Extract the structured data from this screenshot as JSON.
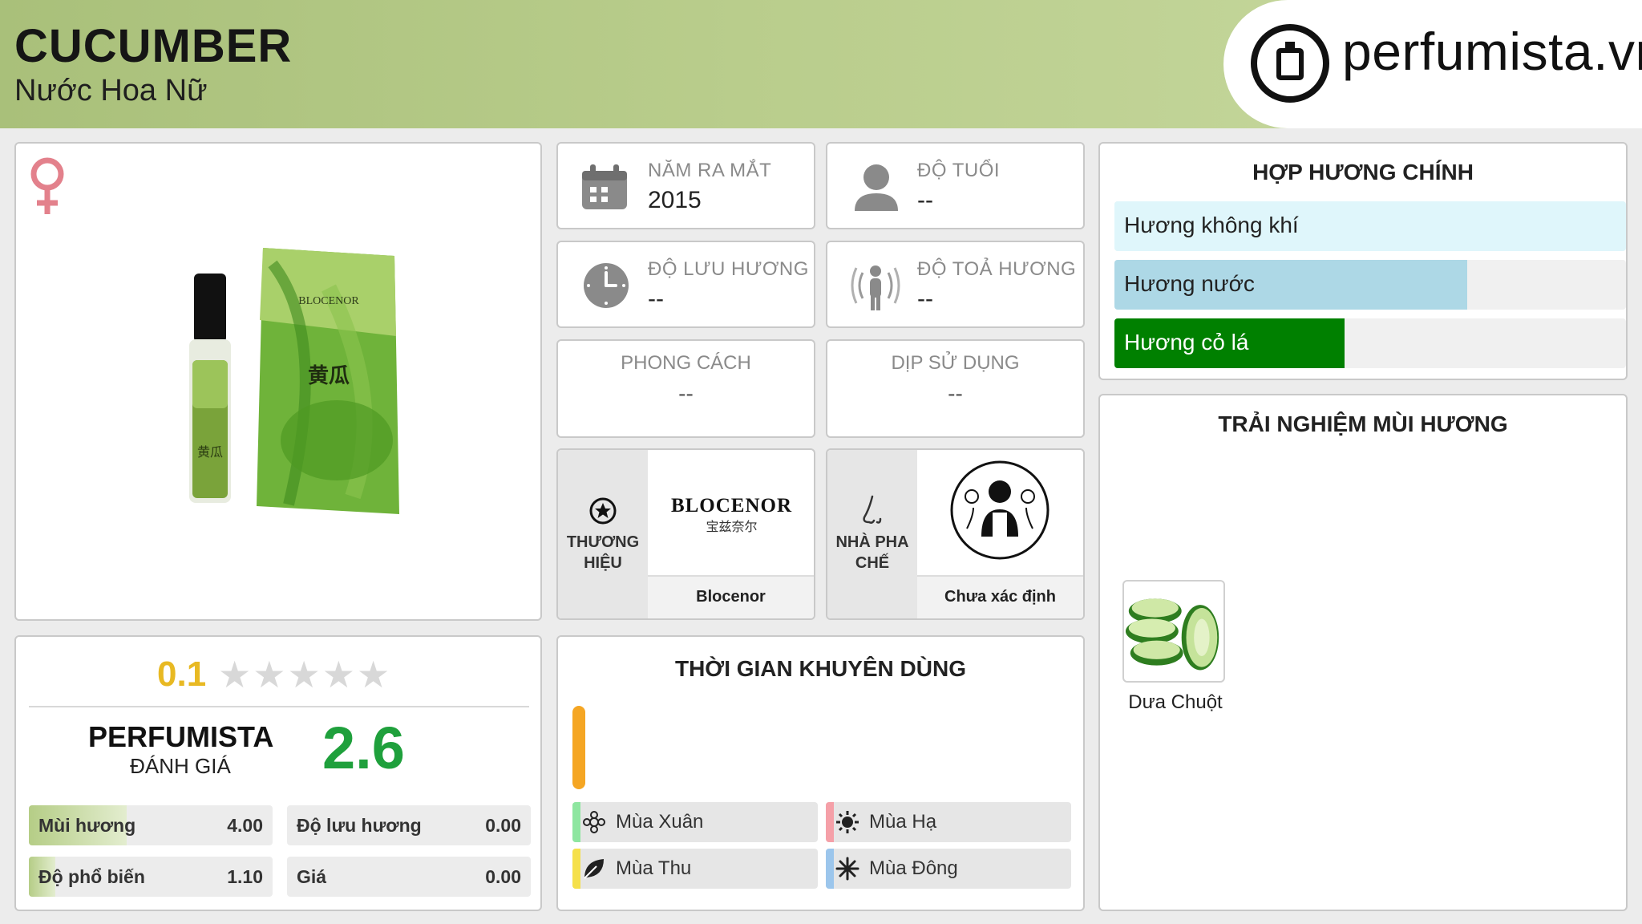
{
  "header": {
    "title": "CUCUMBER",
    "subtitle": "Nước Hoa Nữ",
    "site": "perfumista.vn"
  },
  "product": {
    "gender_icon": "female-icon",
    "image": "perfume-bottle-and-box",
    "packaging_brand_text": "BLOCENOR",
    "packaging_cn_text": "黄瓜"
  },
  "info": {
    "release_year": {
      "label": "NĂM RA MẮT",
      "value": "2015",
      "icon": "calendar-icon"
    },
    "age": {
      "label": "ĐỘ TUỔI",
      "value": "--",
      "icon": "person-icon"
    },
    "longevity": {
      "label": "ĐỘ LƯU HƯƠNG",
      "value": "--",
      "icon": "clock-icon"
    },
    "sillage": {
      "label": "ĐỘ TOẢ HƯƠNG",
      "value": "--",
      "icon": "radiating-person-icon"
    },
    "style": {
      "label": "PHONG CÁCH",
      "value": "--"
    },
    "occasion": {
      "label": "DỊP SỬ DỤNG",
      "value": "--"
    }
  },
  "brand": {
    "label": "THƯƠNG HIỆU",
    "logo_text": "BLOCENOR",
    "logo_cn": "宝兹奈尔",
    "name": "Blocenor",
    "icon": "star-circle-icon"
  },
  "perfumer": {
    "label": "NHÀ PHA CHẾ",
    "name": "Chưa xác định",
    "icon": "nose-icon"
  },
  "accords": {
    "title": "HỢP HƯƠNG CHÍNH",
    "items": [
      {
        "label": "Hương không khí",
        "level": 1.0,
        "color": "#dff6fb",
        "text_color": "#222222"
      },
      {
        "label": "Hương nước",
        "level": 0.69,
        "color": "#add8e6",
        "text_color": "#222222"
      },
      {
        "label": "Hương cỏ lá",
        "level": 0.45,
        "color": "#008000",
        "text_color": "#ffffff"
      }
    ]
  },
  "experience": {
    "title": "TRẢI NGHIỆM MÙI HƯƠNG",
    "notes": [
      {
        "name": "Dưa Chuột",
        "image": "cucumber-slices"
      }
    ]
  },
  "rating": {
    "user_score": "0.1",
    "stars_filled": 0.02,
    "stars_total": 5,
    "brand_label": "PERFUMISTA",
    "brand_sub": "ĐÁNH GIÁ",
    "brand_score": "2.6",
    "accent": "#e8b923",
    "score_color": "#1fa03c",
    "metrics": [
      {
        "label": "Mùi hương",
        "value": "4.00",
        "level": 0.4
      },
      {
        "label": "Độ lưu hương",
        "value": "0.00",
        "level": 0.0
      },
      {
        "label": "Độ phổ biến",
        "value": "1.10",
        "level": 0.11
      },
      {
        "label": "Giá",
        "value": "0.00",
        "level": 0.0
      }
    ]
  },
  "timing": {
    "title": "THỜI GIAN KHUYÊN DÙNG",
    "indicator_color": "#f5a623",
    "seasons": [
      {
        "label": "Mùa Xuân",
        "color": "#8ee6a0",
        "icon": "flower-icon"
      },
      {
        "label": "Mùa Hạ",
        "color": "#f5a0a8",
        "icon": "sun-icon"
      },
      {
        "label": "Mùa Thu",
        "color": "#f5e04a",
        "icon": "leaf-icon"
      },
      {
        "label": "Mùa Đông",
        "color": "#9cc6ec",
        "icon": "snowflake-icon"
      }
    ]
  }
}
